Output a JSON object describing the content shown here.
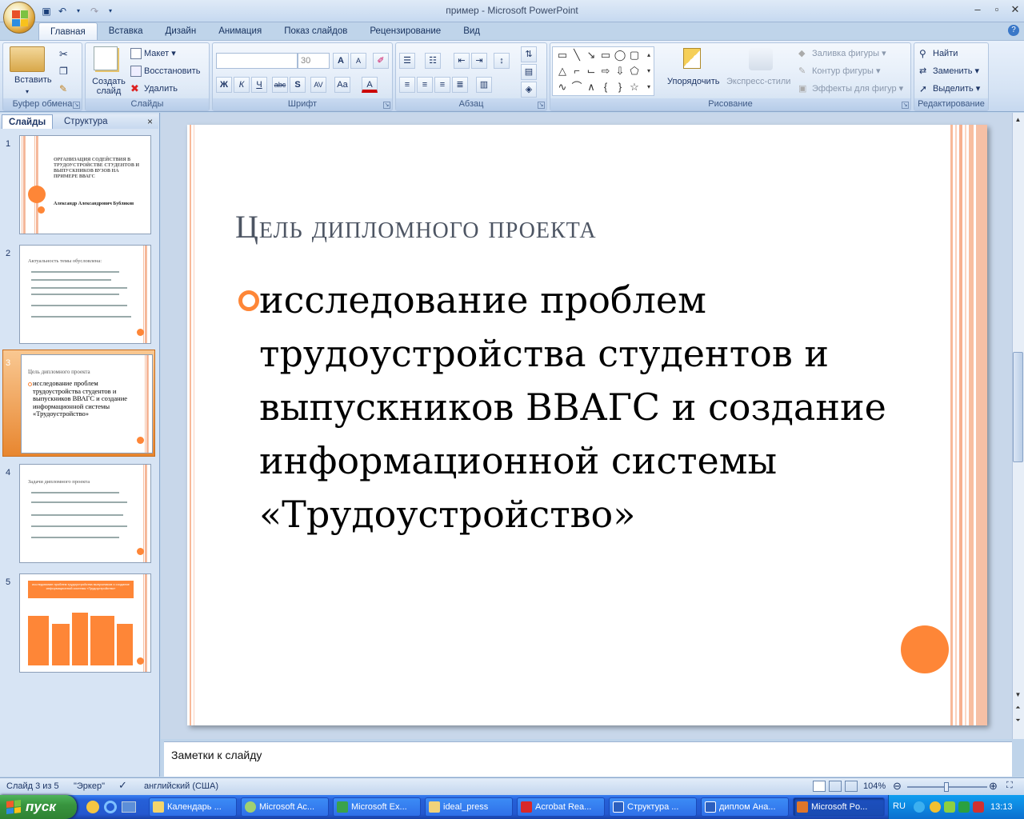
{
  "window": {
    "title": "пример - Microsoft PowerPoint"
  },
  "tabs": [
    "Главная",
    "Вставка",
    "Дизайн",
    "Анимация",
    "Показ слайдов",
    "Рецензирование",
    "Вид"
  ],
  "ribbon": {
    "clipboard": {
      "label": "Буфер обмена",
      "paste": "Вставить"
    },
    "slides": {
      "label": "Слайды",
      "new_slide": "Создать слайд",
      "layout": "Макет",
      "reset": "Восстановить",
      "delete": "Удалить"
    },
    "font": {
      "label": "Шрифт",
      "font_size": "30"
    },
    "paragraph": {
      "label": "Абзац"
    },
    "drawing": {
      "label": "Рисование",
      "arrange": "Упорядочить",
      "quick_styles": "Экспресс-стили",
      "fill": "Заливка фигуры",
      "outline": "Контур фигуры",
      "effects": "Эффекты для фигур"
    },
    "editing": {
      "label": "Редактирование",
      "find": "Найти",
      "replace": "Заменить",
      "select": "Выделить"
    }
  },
  "left_pane": {
    "tabs": [
      "Слайды",
      "Структура"
    ],
    "thumbs": [
      {
        "num": "1",
        "title": "ОРГАНИЗАЦИЯ СОДЕЙСТВИЯ В ТРУДОУСТРОЙСТВЕ СТУДЕНТОВ И ВЫПУСКНИКОВ ВУЗОВ НА ПРИМЕРЕ ВВАГС",
        "author": "Александр Александрович Бубликов"
      },
      {
        "num": "2",
        "title": "Актуальность темы обусловлена:"
      },
      {
        "num": "3",
        "title": "Цель дипломного проекта",
        "body": "исследование проблем трудоустройства студентов и выпускников ВВАГС и создание информационной системы «Трудоустройство»"
      },
      {
        "num": "4",
        "title": "Задачи дипломного проекта"
      },
      {
        "num": "5",
        "title": "исследование проблем трудоустройства выпускников и создание информационной системы «Трудоустройство»"
      }
    ]
  },
  "slide": {
    "title": "Цель дипломного проекта",
    "body": "исследование проблем трудоустройства студентов и выпускников ВВАГС и создание информационной системы «Трудоустройство»"
  },
  "notes_placeholder": "Заметки к слайду",
  "status": {
    "slide_of": "Слайд 3 из 5",
    "theme": "\"Эркер\"",
    "language": "английский (США)",
    "zoom": "104%"
  },
  "taskbar": {
    "start": "пуск",
    "buttons": [
      "Календарь ...",
      "Microsoft Ac...",
      "Microsoft Ex...",
      "ideal_press",
      "Acrobat Rea...",
      "Структура ...",
      "диплом Ана...",
      "Microsoft Po..."
    ],
    "lang": "RU",
    "clock": "13:13"
  },
  "colors": {
    "accent": "#fe8637",
    "ribbon": "#d5e3f4",
    "taskbar": "#2458cf"
  }
}
